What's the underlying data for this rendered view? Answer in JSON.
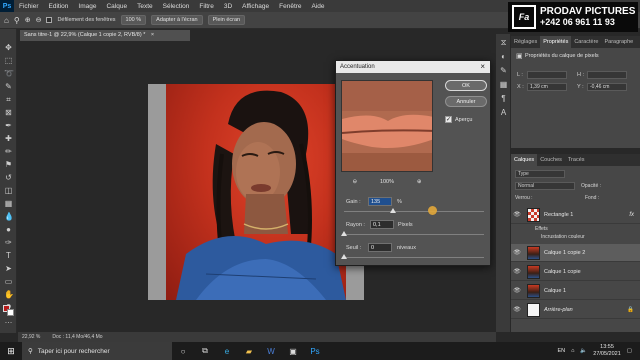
{
  "menu": {
    "logo": "Ps",
    "items": [
      "Fichier",
      "Edition",
      "Image",
      "Calque",
      "Texte",
      "Sélection",
      "Filtre",
      "3D",
      "Affichage",
      "Fenêtre",
      "Aide"
    ]
  },
  "options_bar": {
    "scroll_all_label": "Défilement des fenêtres",
    "zoom_value": "100 %",
    "fit_screen_button": "Adapter à l'écran",
    "fill_screen_button": "Plein écran"
  },
  "brand": {
    "logo": "Fa",
    "name": "PRODAV PICTURES",
    "phone": "+242 06 961 11 93"
  },
  "document": {
    "tab_title": "Sans titre-1 @ 22,9% (Calque 1 copie 2, RVB/8) *",
    "tab_close": "×",
    "status_zoom": "22,92 %",
    "status_doc": "Doc : 11,4 Mo/46,4 Mo"
  },
  "dialog": {
    "title": "Accentuation",
    "close": "×",
    "ok": "OK",
    "cancel": "Annuler",
    "preview_label": "Aperçu",
    "preview_checked": "✓",
    "zoom_level": "100%",
    "zoom_out": "⊖",
    "zoom_in": "⊕",
    "gain_label": "Gain :",
    "gain_value": "135",
    "gain_unit": "%",
    "radius_label": "Rayon :",
    "radius_value": "0,1",
    "radius_unit": "Pixels",
    "threshold_label": "Seuil :",
    "threshold_value": "0",
    "threshold_unit": "niveaux",
    "gain_slider_pct": 0.35,
    "radius_slider_pct": 0.0,
    "threshold_slider_pct": 0.0
  },
  "properties": {
    "tabs": [
      "Réglages",
      "Propriétés",
      "Caractère",
      "Paragraphe"
    ],
    "active_tab": "Propriétés",
    "title": "Propriétés du calque de pixels",
    "w_label": "L :",
    "h_label": "H :",
    "x_label": "X :",
    "y_label": "Y :",
    "x_value": "1,39 cm",
    "y_value": "-0,46 cm"
  },
  "layers": {
    "tabs": [
      "Calques",
      "Couches",
      "Tracés"
    ],
    "active_tab": "Calques",
    "kind_placeholder": "Type",
    "blend_mode": "Normal",
    "opacity_label": "Opacité :",
    "lock_label": "Verrou :",
    "fill_label": "Fond :",
    "items": [
      {
        "name": "Rectangle 1",
        "thumb": "checker",
        "fx": "fx",
        "selected": false
      },
      {
        "name": "Calque 1 copie 2",
        "thumb": "portrait",
        "fx": "",
        "selected": true
      },
      {
        "name": "Calque 1 copie",
        "thumb": "portrait",
        "fx": "",
        "selected": false
      },
      {
        "name": "Calque 1",
        "thumb": "portrait",
        "fx": "",
        "selected": false
      },
      {
        "name": "Arrière-plan",
        "thumb": "white",
        "fx": "",
        "selected": false
      }
    ],
    "effects_label": "Effets",
    "effect_item": "Incrustation couleur"
  },
  "taskbar": {
    "search_placeholder": "Taper ici pour rechercher",
    "language": "EN",
    "time": "13:55",
    "date": "27/05/2021"
  },
  "colors": {
    "accent_blue": "#31a8ff",
    "foreground": "#b71c1c",
    "background": "#ffffff"
  }
}
